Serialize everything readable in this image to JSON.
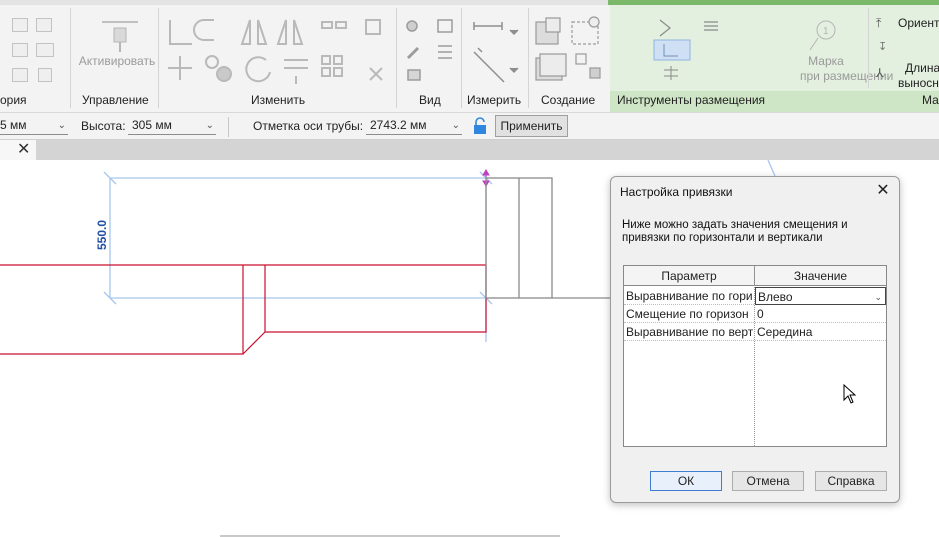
{
  "ribbon": {
    "panels": {
      "left_cut": "ория",
      "manage": "Управление",
      "modify": "Изменить",
      "view": "Вид",
      "measure": "Измерить",
      "create": "Создание",
      "placement_tools": "Инструменты размещения",
      "right_cut": "Ма"
    },
    "activate_label": "Активировать",
    "tag_label_line1": "Марка",
    "tag_label_line2": "при размещении",
    "orient_label": "Ориент",
    "length_label_line1": "Длина",
    "length_label_line2": "выносн"
  },
  "options_bar": {
    "width_value": "5 мм",
    "height_label": "Высота:",
    "height_value": "305 мм",
    "elevation_label": "Отметка оси трубы:",
    "elevation_value": "2743.2 мм",
    "apply_label": "Применить"
  },
  "tab": {
    "close_glyph": "✕"
  },
  "canvas": {
    "dimension_text": "550.0"
  },
  "dialog": {
    "title": "Настройка привязки",
    "description": "Ниже можно задать значения смещения и привязки по горизонтали и вертикали",
    "col_param": "Параметр",
    "col_value": "Значение",
    "rows": [
      {
        "param": "Выравнивание по гори",
        "value": "Влево"
      },
      {
        "param": "Смещение по горизон",
        "value": "0"
      },
      {
        "param": "Выравнивание по верт",
        "value": "Середина"
      }
    ],
    "ok": "ОК",
    "cancel": "Отмена",
    "help": "Справка"
  },
  "colors": {
    "duct_red": "#c8102e",
    "dimension_blue": "#1f4fa3",
    "guide_blue": "#a8c6ee",
    "placement_green": "#cfe6c6"
  }
}
